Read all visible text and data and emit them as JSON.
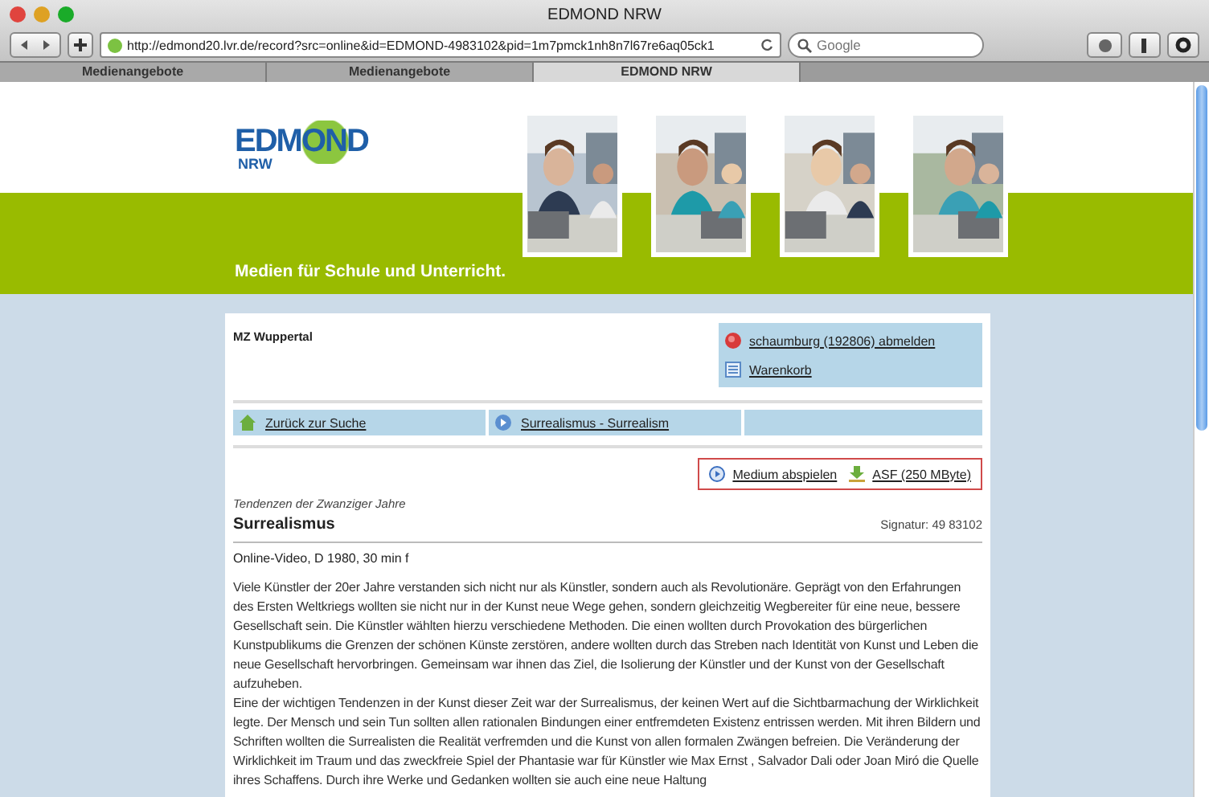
{
  "window": {
    "title": "EDMOND NRW"
  },
  "toolbar": {
    "url": "http://edmond20.lvr.de/record?src=online&id=EDMOND-4983102&pid=1m7pmck1nh8n7l67re6aq05ck1",
    "search_placeholder": "Google"
  },
  "tabs": [
    {
      "label": "Medienangebote",
      "selected": false
    },
    {
      "label": "Medienangebote",
      "selected": false
    },
    {
      "label": "EDMOND NRW",
      "selected": true
    }
  ],
  "header": {
    "logo_main": "EDMOND",
    "logo_sub": "NRW",
    "tagline": "Medien für Schule und Unterricht."
  },
  "account": {
    "location": "MZ Wuppertal",
    "logout": "schaumburg (192806) abmelden",
    "cart": "Warenkorb"
  },
  "nav": {
    "back": "Zurück zur Suche",
    "category": "Surrealismus - Surrealism"
  },
  "actions": {
    "play": "Medium abspielen",
    "download": "ASF (250 MByte)"
  },
  "record": {
    "series": "Tendenzen der Zwanziger Jahre",
    "title": "Surrealismus",
    "signature": "Signatur: 49 83102",
    "meta": "Online-Video,  D 1980, 30 min f",
    "paragraphs": [
      "Viele Künstler der 20er Jahre verstanden sich nicht nur als Künstler, sondern auch als Revolutionäre. Geprägt von den Erfahrungen des Ersten Weltkriegs wollten sie nicht nur in der Kunst neue Wege gehen, sondern gleichzeitig Wegbereiter für eine neue, bessere Gesellschaft sein. Die Künstler wählten hierzu verschiedene Methoden. Die einen wollten durch Provokation des bürgerlichen Kunstpublikums die Grenzen der schönen Künste zerstören, andere wollten durch das Streben nach Identität von Kunst und Leben die neue Gesellschaft hervorbringen. Gemeinsam war ihnen das Ziel, die Isolierung der Künstler und der Kunst von der Gesellschaft aufzuheben.",
      "Eine der wichtigen Tendenzen in der Kunst dieser Zeit war der Surrealismus, der keinen Wert auf die Sichtbarmachung der Wirklichkeit legte. Der Mensch und sein Tun sollten allen rationalen Bindungen einer entfremdeten Existenz entrissen werden. Mit ihren Bildern und Schriften wollten die Surrealisten die Realität verfremden und die Kunst von allen formalen Zwängen befreien. Die Veränderung der Wirklichkeit im Traum und das zweckfreie Spiel der Phantasie war für Künstler wie Max Ernst , Salvador Dali oder Joan Miró die Quelle ihres Schaffens. Durch ihre Werke und Gedanken wollten sie auch eine neue Haltung"
    ]
  }
}
